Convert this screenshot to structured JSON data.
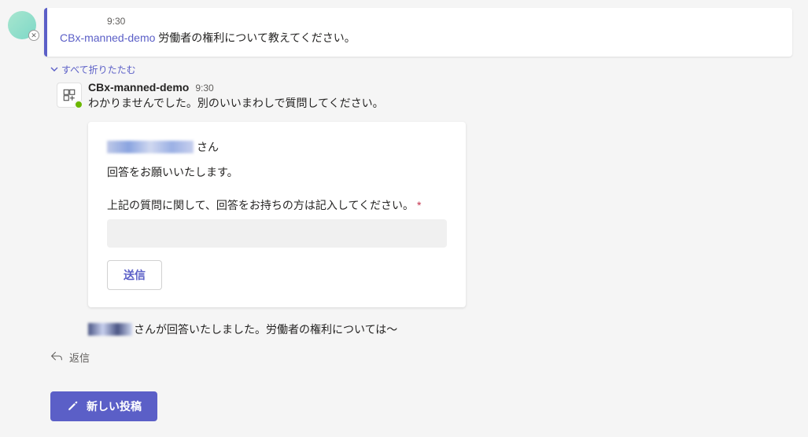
{
  "mainMessage": {
    "time": "9:30",
    "mention": "CBx-manned-demo",
    "text": " 労働者の権利について教えてください。"
  },
  "collapse": {
    "label": "すべて折りたたむ"
  },
  "reply": {
    "botName": "CBx-manned-demo",
    "time": "9:30",
    "text": "わかりませんでした。別のいいまわしで質問してください。"
  },
  "card": {
    "userSuffix": "さん",
    "instruction": "回答をお願いいたします。",
    "fieldLabel": "上記の質問に関して、回答をお持ちの方は記入してください。",
    "requiredMark": "*",
    "inputValue": "",
    "submitLabel": "送信"
  },
  "answerLine": {
    "text": "さんが回答いたしました。労働者の権利については～"
  },
  "replyAction": {
    "label": "返信"
  },
  "newPost": {
    "label": "新しい投稿"
  }
}
